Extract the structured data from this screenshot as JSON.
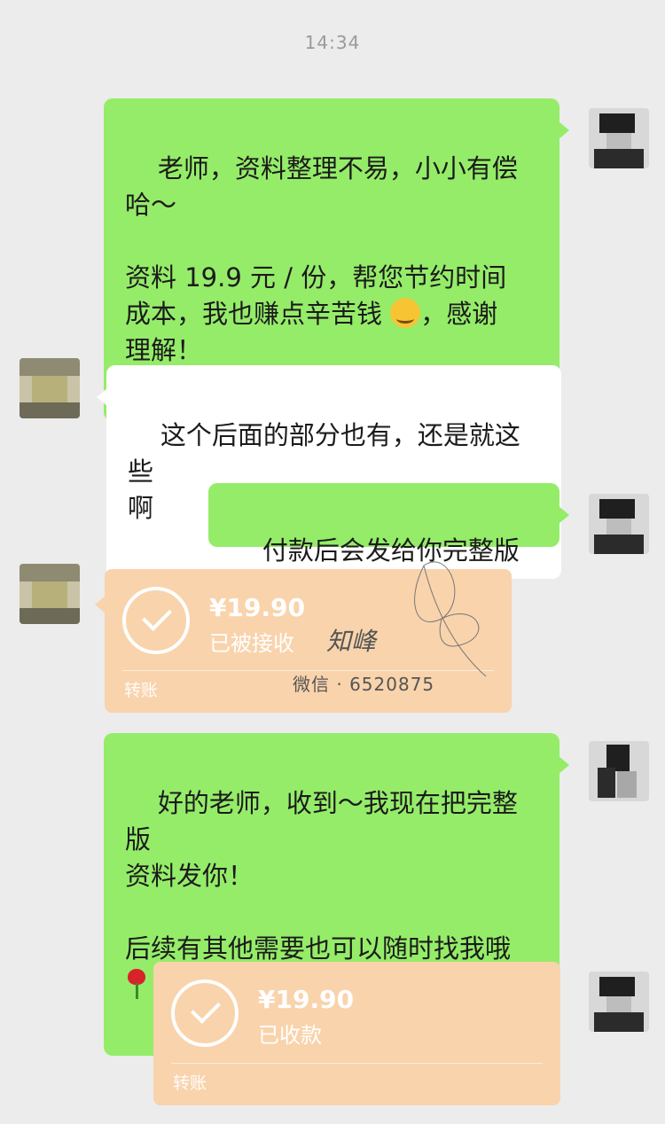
{
  "chat": {
    "timestamp": "14:34",
    "messages": [
      {
        "side": "me",
        "type": "text",
        "paragraph1": "老师，资料整理不易，小小有偿\n哈～",
        "paragraph2_part1": "资料 19.9 元 / 份，帮您节约时间\n成本，我也赚点辛苦钱 ",
        "emoji": "smile-emoji",
        "paragraph2_part2": "，感谢\n理解！"
      },
      {
        "side": "peer",
        "type": "text",
        "text": "这个后面的部分也有，还是就这些\n啊"
      },
      {
        "side": "me",
        "type": "text",
        "text": "付款后会发给你完整版的"
      },
      {
        "side": "peer",
        "type": "transfer",
        "amount": "¥19.90",
        "status": "已被接收",
        "label": "转账"
      },
      {
        "side": "me",
        "type": "text",
        "paragraph1": "好的老师，收到～我现在把完整版\n资料发你！",
        "paragraph2": "后续有其他需要也可以随时找我哦",
        "emoji": "rose-emoji"
      },
      {
        "side": "me",
        "type": "transfer",
        "amount": "¥19.90",
        "status": "已收款",
        "label": "转账"
      }
    ]
  },
  "watermark": {
    "signature": "知峰",
    "contact": "微信 · 6520875"
  },
  "colors": {
    "background": "#ececec",
    "my_bubble": "#95ec69",
    "peer_bubble": "#ffffff",
    "transfer": "#f9d3ac"
  }
}
